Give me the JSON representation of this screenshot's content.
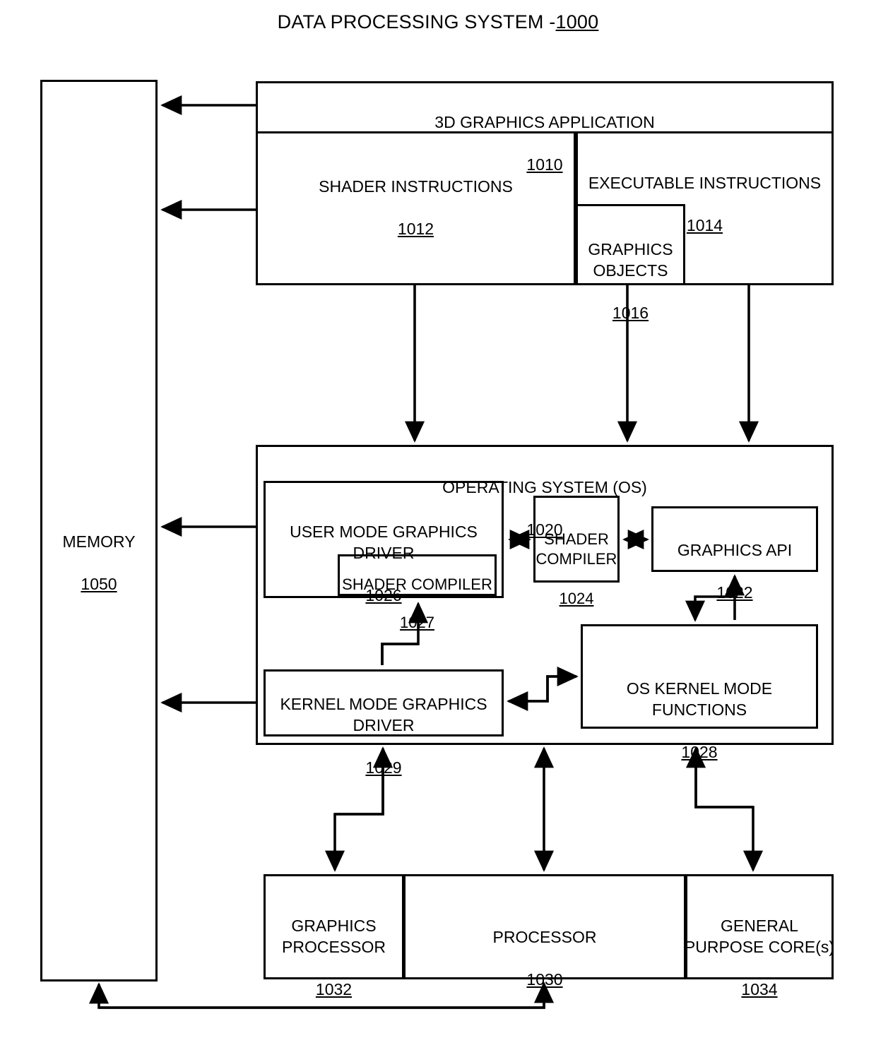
{
  "figure": {
    "title_text": "DATA PROCESSING SYSTEM -",
    "title_ref": "1000"
  },
  "blocks": {
    "memory": {
      "label": "MEMORY",
      "ref": "1050"
    },
    "application": {
      "label": "3D GRAPHICS APPLICATION",
      "ref": "1010"
    },
    "shader_instructions": {
      "label": "SHADER INSTRUCTIONS",
      "ref": "1012"
    },
    "executable_instructions": {
      "label": "EXECUTABLE INSTRUCTIONS",
      "ref": "1014"
    },
    "graphics_objects": {
      "label": "GRAPHICS\nOBJECTS",
      "ref": "1016"
    },
    "operating_system": {
      "label": "OPERATING SYSTEM (OS)",
      "ref": "1020"
    },
    "user_mode_graphics_driver": {
      "label": "USER MODE GRAPHICS DRIVER",
      "ref": "1026"
    },
    "shader_compiler_umd": {
      "label": "SHADER COMPILER",
      "ref": "1027"
    },
    "shader_compiler_os": {
      "label": "SHADER\nCOMPILER",
      "ref": "1024"
    },
    "graphics_api": {
      "label": "GRAPHICS API",
      "ref": "1022"
    },
    "os_kernel_mode_functions": {
      "label": "OS KERNEL MODE FUNCTIONS",
      "ref": "1028"
    },
    "kernel_mode_graphics_driver": {
      "label": "KERNEL MODE GRAPHICS\nDRIVER",
      "ref": "1029"
    },
    "graphics_processor": {
      "label": "GRAPHICS\nPROCESSOR",
      "ref": "1032"
    },
    "processor": {
      "label": "PROCESSOR",
      "ref": "1030"
    },
    "general_purpose_cores": {
      "label": "GENERAL\nPURPOSE CORE(s)",
      "ref": "1034"
    }
  },
  "colors": {
    "stroke": "#000000",
    "background": "#ffffff"
  }
}
